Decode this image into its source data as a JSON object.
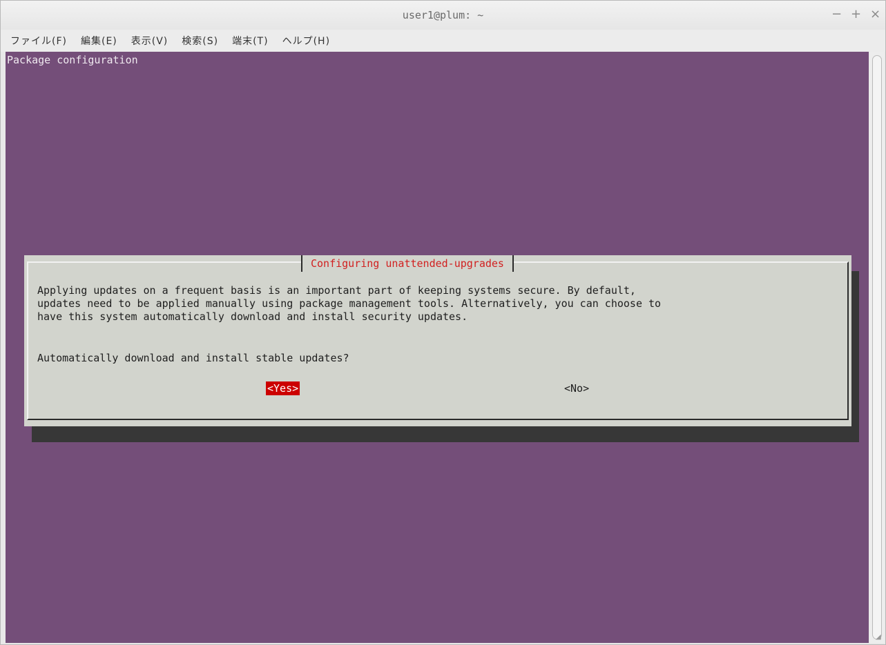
{
  "window": {
    "title": "user1@plum: ~",
    "buttons": {
      "minimize": "−",
      "maximize": "+",
      "close": "×"
    }
  },
  "menubar": {
    "items": [
      "ファイル(F)",
      "編集(E)",
      "表示(V)",
      "検索(S)",
      "端末(T)",
      "ヘルプ(H)"
    ]
  },
  "terminal": {
    "header": "Package configuration",
    "background": "#744e79"
  },
  "dialog": {
    "title": "Configuring unattended-upgrades",
    "text": "Applying updates on a frequent basis is an important part of keeping systems secure. By default,\nupdates need to be applied manually using package management tools. Alternatively, you can choose to\nhave this system automatically download and install security updates.",
    "question": "Automatically download and install stable updates?",
    "yes_label": "<Yes>",
    "no_label": "<No>",
    "selected": "<Yes>",
    "accent_color": "#cc0000"
  }
}
